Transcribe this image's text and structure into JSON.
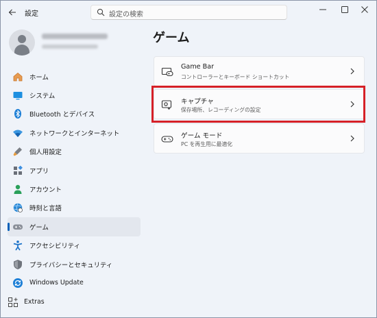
{
  "window": {
    "title": "設定"
  },
  "search": {
    "placeholder": "設定の検索"
  },
  "sidebar": {
    "items": [
      {
        "label": "ホーム",
        "icon": "home-icon",
        "active": false
      },
      {
        "label": "システム",
        "icon": "system-icon",
        "active": false
      },
      {
        "label": "Bluetooth とデバイス",
        "icon": "bluetooth-icon",
        "active": false
      },
      {
        "label": "ネットワークとインターネット",
        "icon": "network-icon",
        "active": false
      },
      {
        "label": "個人用設定",
        "icon": "personalization-icon",
        "active": false
      },
      {
        "label": "アプリ",
        "icon": "apps-icon",
        "active": false
      },
      {
        "label": "アカウント",
        "icon": "account-icon",
        "active": false
      },
      {
        "label": "時刻と言語",
        "icon": "time-language-icon",
        "active": false
      },
      {
        "label": "ゲーム",
        "icon": "gaming-icon",
        "active": true
      },
      {
        "label": "アクセシビリティ",
        "icon": "accessibility-icon",
        "active": false
      },
      {
        "label": "プライバシーとセキュリティ",
        "icon": "privacy-shield-icon",
        "active": false
      },
      {
        "label": "Windows Update",
        "icon": "windows-update-icon",
        "active": false
      }
    ],
    "extras": {
      "label": "Extras",
      "icon": "extras-icon"
    }
  },
  "main": {
    "title": "ゲーム",
    "cards": [
      {
        "title": "Game Bar",
        "desc": "コントローラーとキーボード ショートカット",
        "icon": "game-bar-icon"
      },
      {
        "title": "キャプチャ",
        "desc": "保存場所、レコーディングの設定",
        "icon": "capture-icon"
      },
      {
        "title": "ゲーム モード",
        "desc": "PC を再生用に最適化",
        "icon": "game-mode-icon"
      }
    ]
  },
  "colors": {
    "accent": "#005fb8",
    "highlight": "#d62027",
    "background": "#eff3f9"
  }
}
